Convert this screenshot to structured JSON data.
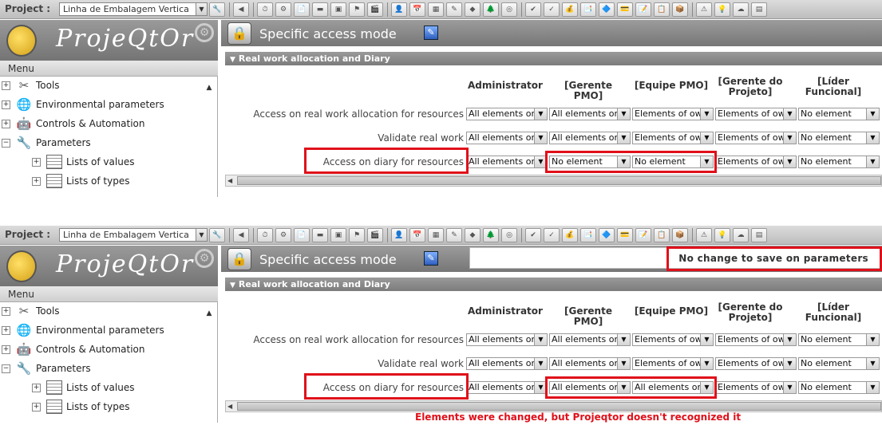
{
  "app": {
    "project_label": "Project :",
    "project_value": "Linha de Embalagem Vertica",
    "logo_text": "ProjeQtOr",
    "menu_title": "Menu",
    "page_title": "Specific access mode",
    "section_title": "Real work allocation and Diary"
  },
  "toolbar_icons": [
    "history-icon",
    "today-icon",
    "parameters-icon",
    "notes-icon",
    "project-icon",
    "planning-icon",
    "portfolio-icon",
    "flag-icon",
    "clapper-icon",
    "user-icon",
    "calendar-icon",
    "tickets-icon",
    "activities-icon",
    "milestones-icon",
    "tree-icon",
    "targets-icon",
    "validate-icon",
    "approve-icon",
    "expenses-icon",
    "bills-icon",
    "docs-icon",
    "payment-icon",
    "quotations-icon",
    "orders-icon",
    "terms-icon",
    "risks-icon",
    "ideas-icon",
    "weather-icon",
    "presentation-icon"
  ],
  "tree": [
    {
      "label": "Tools",
      "icon": "tools-icon",
      "exp": "+"
    },
    {
      "label": "Environmental parameters",
      "icon": "globe-icon",
      "exp": "+"
    },
    {
      "label": "Controls & Automation",
      "icon": "robot-icon",
      "exp": "+"
    },
    {
      "label": "Parameters",
      "icon": "wrench-icon",
      "exp": "−"
    },
    {
      "label": "Lists of values",
      "icon": "list-icon",
      "exp": "+"
    },
    {
      "label": "Lists of types",
      "icon": "list-icon",
      "exp": "+"
    }
  ],
  "columns": [
    "Administrator",
    "[Gerente PMO]",
    "[Equipe PMO]",
    "[Gerente do Projeto]",
    "[Líder Funcional]"
  ],
  "row_labels": [
    "Access on real work allocation for resources",
    "Validate real work",
    "Access on diary for resources"
  ],
  "top_panel": {
    "message": "",
    "values": [
      [
        "All elements on",
        "All elements on",
        "Elements of own",
        "Elements of own",
        "No element"
      ],
      [
        "All elements on",
        "All elements on",
        "Elements of own",
        "Elements of own",
        "No element"
      ],
      [
        "All elements on",
        "No element",
        "No element",
        "Elements of own",
        "No element"
      ]
    ]
  },
  "bottom_panel": {
    "message": "No change to save on parameters",
    "values": [
      [
        "All elements on",
        "All elements on",
        "Elements of own",
        "Elements of own",
        "No element"
      ],
      [
        "All elements on",
        "All elements on",
        "Elements of own",
        "Elements of own",
        "No element"
      ],
      [
        "All elements on",
        "All elements on",
        "All elements on",
        "Elements of own",
        "No element"
      ]
    ]
  },
  "caption": "Elements were changed, but Projeqtor doesn't recognized it",
  "colors": {
    "highlight": "#e0101a",
    "header": "#888888"
  }
}
